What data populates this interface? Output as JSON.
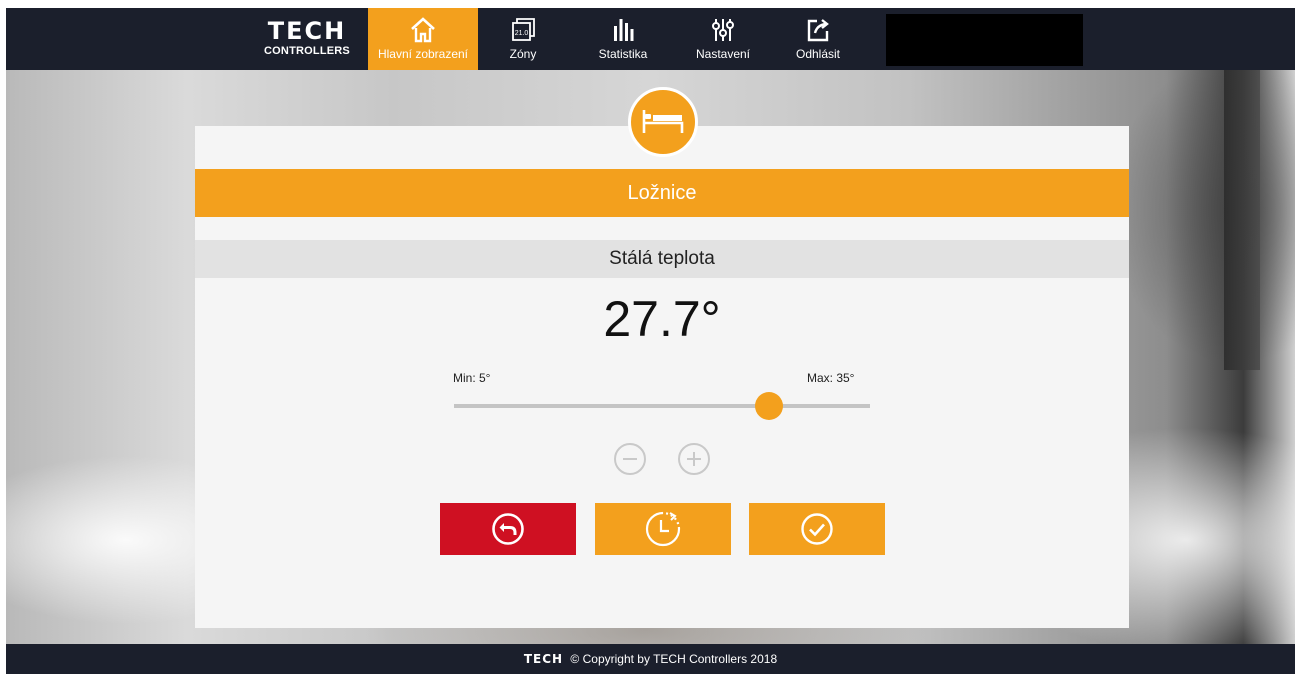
{
  "nav": {
    "logo_main": "TECH",
    "logo_sub": "CONTROLLERS",
    "items": [
      {
        "label": "Hlavní zobrazení",
        "icon": "home-icon",
        "active": true
      },
      {
        "label": "Zóny",
        "icon": "zones-icon",
        "icon_text": "21.0"
      },
      {
        "label": "Statistika",
        "icon": "statistics-icon"
      },
      {
        "label": "Nastavení",
        "icon": "settings-sliders-icon"
      },
      {
        "label": "Odhlásit",
        "icon": "logout-icon"
      }
    ]
  },
  "zone": {
    "name": "Ložnice",
    "icon": "bed-icon",
    "mode": "Stálá teplota",
    "temperature_display": "27.7°",
    "temperature_value": 27.7,
    "min_label": "Min: 5°",
    "max_label": "Max: 35°",
    "min": 5,
    "max": 35
  },
  "controls": {
    "decrease_icon": "minus-circle-icon",
    "increase_icon": "plus-circle-icon",
    "back_icon": "back-arrow-icon",
    "schedule_icon": "schedule-clock-icon",
    "confirm_icon": "check-circle-icon"
  },
  "footer": {
    "logo": "TECH",
    "text": "© Copyright by TECH Controllers 2018"
  },
  "colors": {
    "accent": "#f3a01d",
    "back_button": "#cf1022",
    "topbar": "#1b1f2c"
  }
}
